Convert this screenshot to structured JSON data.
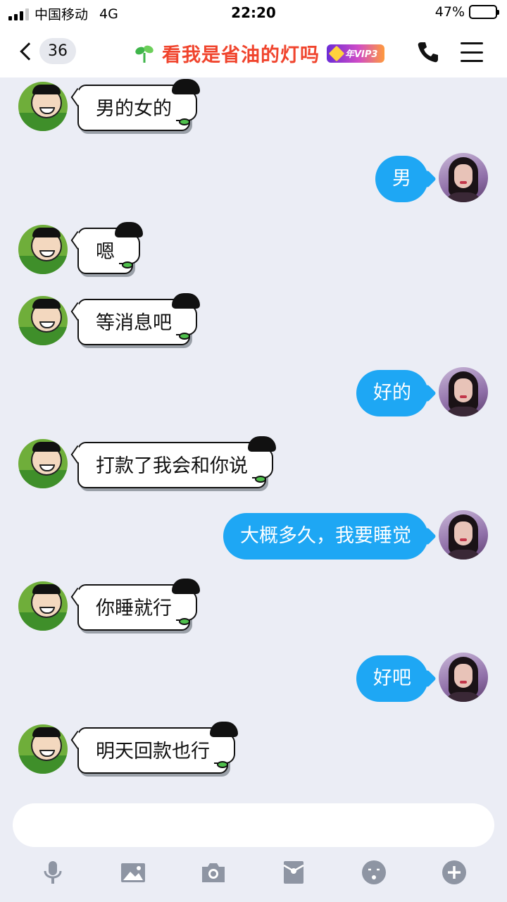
{
  "status": {
    "carrier": "中国移动",
    "network": "4G",
    "time": "22:20",
    "battery": "47%",
    "battery_level": 0.47
  },
  "header": {
    "back_count": "36",
    "title": "看我是省油的灯吗",
    "vip_badge": "年VIP3",
    "title_color": "#f0442d"
  },
  "messages": [
    {
      "side": "left",
      "text": "男的女的"
    },
    {
      "side": "right",
      "text": "男"
    },
    {
      "side": "left",
      "text": "嗯"
    },
    {
      "side": "left",
      "text": "等消息吧"
    },
    {
      "side": "right",
      "text": "好的"
    },
    {
      "side": "left",
      "text": "打款了我会和你说"
    },
    {
      "side": "right",
      "text": "大概多久，我要睡觉"
    },
    {
      "side": "left",
      "text": "你睡就行"
    },
    {
      "side": "right",
      "text": "好吧"
    },
    {
      "side": "left",
      "text": "明天回款也行"
    }
  ],
  "input": {
    "value": "",
    "placeholder": ""
  },
  "toolbar": [
    "microphone-icon",
    "image-icon",
    "camera-icon",
    "red-packet-icon",
    "emoji-icon",
    "plus-icon"
  ],
  "colors": {
    "bubble_self": "#1ea7f4",
    "bubble_other": "#ffffff",
    "background": "#ebedf5"
  }
}
